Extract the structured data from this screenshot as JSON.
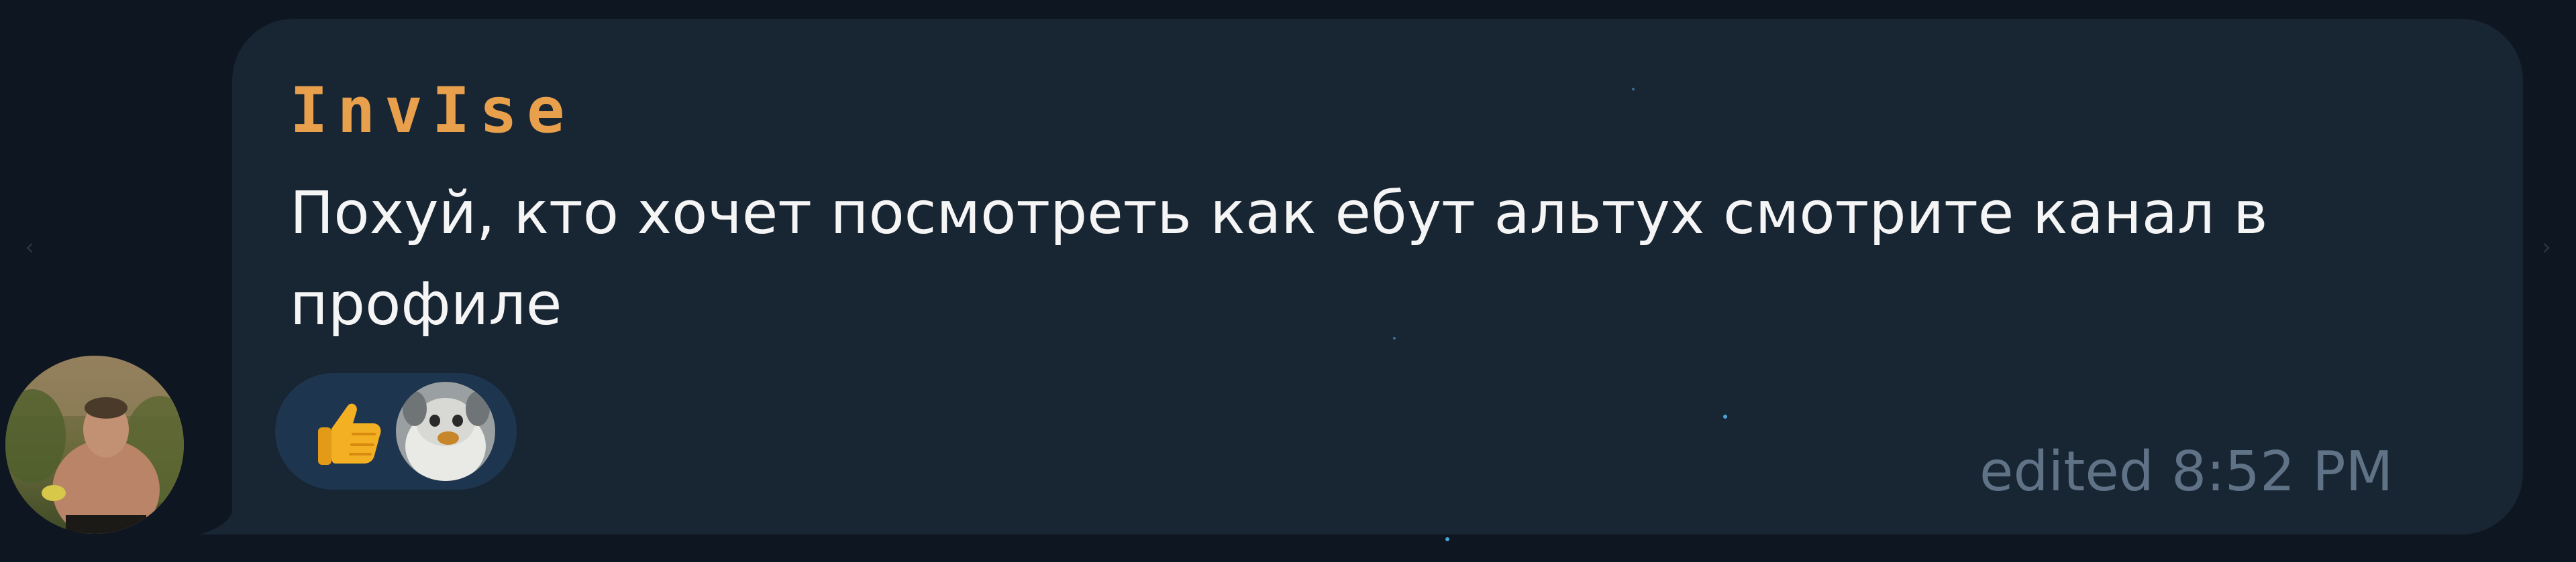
{
  "message": {
    "sender": "InvIse",
    "text": "Похуй, кто хочет посмотреть как ебут альтух смотрите канал в профиле",
    "meta_text": "edited 8:52 PM"
  },
  "reactions": [
    {
      "icon": "thumbs-up-icon"
    },
    {
      "icon": "reactor-avatar"
    }
  ],
  "navigation": {
    "left_arrow": "‹",
    "right_arrow": "›"
  },
  "colors": {
    "background": "#0e1621",
    "bubble": "#182533",
    "sender_name": "#e8a04c",
    "message_text": "#f5f5f5",
    "meta": "#5f7286",
    "reaction_pill": "#1e3550"
  }
}
